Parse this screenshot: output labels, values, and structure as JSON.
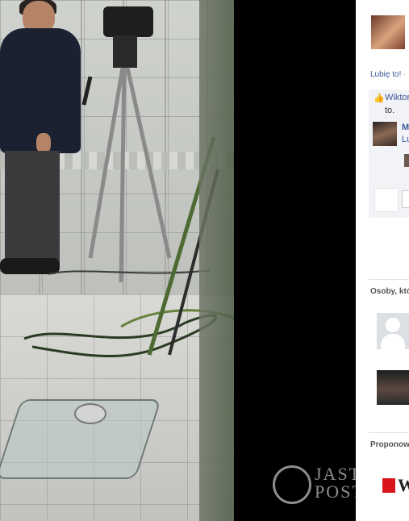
{
  "photo": {
    "description_icon": "photo"
  },
  "watermark": {
    "line1": "JASTRZĄB",
    "line2": "POST",
    "logo_icon": "bird-logo-icon"
  },
  "sidebar": {
    "like_link": "Lubię to!",
    "like_separator": "·",
    "likes": {
      "thumb_icon": "thumbs-up-icon",
      "liker_name": "Wiktoria",
      "suffix": "to."
    },
    "comment": {
      "author": "M",
      "action": "Lu"
    },
    "people_section_title": "Osoby, któ",
    "suggested_section_title": "Proponow",
    "suggested_letter": "W"
  },
  "colors": {
    "fb_blue": "#3b5998",
    "text": "#333333",
    "muted": "#999999",
    "like_box_bg": "#f2f3f7",
    "brand_red": "#d8161c"
  }
}
